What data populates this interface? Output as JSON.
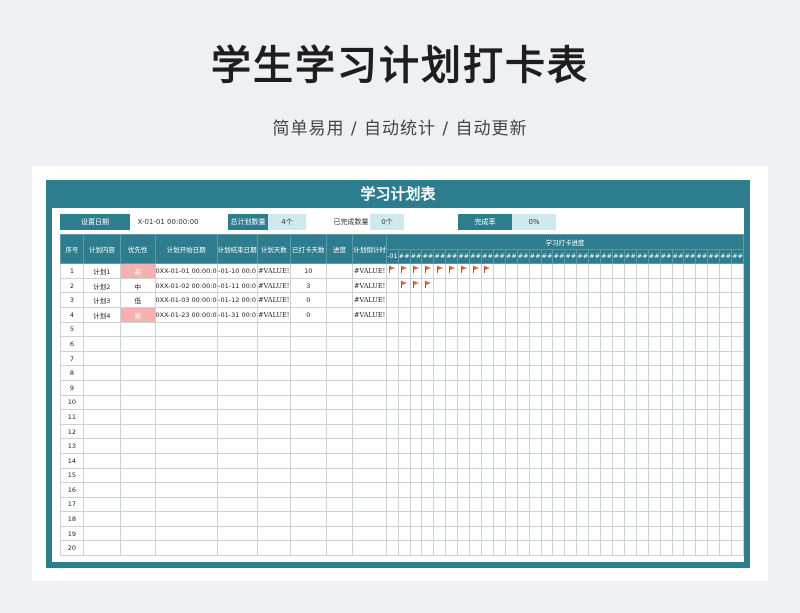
{
  "page": {
    "title": "学生学习计划打卡表",
    "subtitle": "简单易用 / 自动统计 / 自动更新"
  },
  "sheet": {
    "title": "学习计划表",
    "info": {
      "set_date_label": "设置日期",
      "set_date_value": "X-01-01 00:00:00",
      "total_label": "总计划数量",
      "total_value": "4个",
      "done_label": "已完成数量",
      "done_value": "0个",
      "rate_label": "完成率",
      "rate_value": "0%"
    },
    "headers": {
      "no": "序号",
      "content": "计划内容",
      "priority": "优先性",
      "start": "计划开始日期",
      "end": "计划结束日期",
      "days": "计划天数",
      "checked": "已打卡天数",
      "progress": "进度",
      "countdown": "计划倒计时",
      "checkin_group": "学习打卡进度",
      "first_day": "-01",
      "other_day": "##"
    },
    "day_columns": 30,
    "rows": [
      {
        "no": "1",
        "content": "计划1",
        "priority": "高",
        "high": true,
        "start": "0XX-01-01 00:00:0",
        "end": "-01-10 00:0",
        "days": "#VALUE!",
        "checked": "10",
        "progress": "",
        "countdown": "#VALUE!",
        "flags": 9
      },
      {
        "no": "2",
        "content": "计划2",
        "priority": "中",
        "high": false,
        "start": "0XX-01-02 00:00:0",
        "end": "-01-11 00:0",
        "days": "#VALUE!",
        "checked": "3",
        "progress": "",
        "countdown": "#VALUE!",
        "flags": 3,
        "flag_offset": 1
      },
      {
        "no": "3",
        "content": "计划3",
        "priority": "低",
        "high": false,
        "start": "0XX-01-03 00:00:0",
        "end": "-01-12 00:0",
        "days": "#VALUE!",
        "checked": "0",
        "progress": "",
        "countdown": "#VALUE!",
        "flags": 0
      },
      {
        "no": "4",
        "content": "计划4",
        "priority": "高",
        "high": true,
        "start": "0XX-01-23 00:00:0",
        "end": "-01-31 00:0",
        "days": "#VALUE!",
        "checked": "0",
        "progress": "",
        "countdown": "#VALUE!",
        "flags": 0
      }
    ],
    "empty_rows": [
      "5",
      "6",
      "7",
      "8",
      "9",
      "10",
      "11",
      "12",
      "13",
      "14",
      "15",
      "16",
      "17",
      "18",
      "19",
      "20"
    ],
    "colors": {
      "header": "#2e7d8e",
      "info_value": "#cfeaef",
      "priority_high": "#f6b0b0",
      "flag": "#e0643f"
    }
  }
}
